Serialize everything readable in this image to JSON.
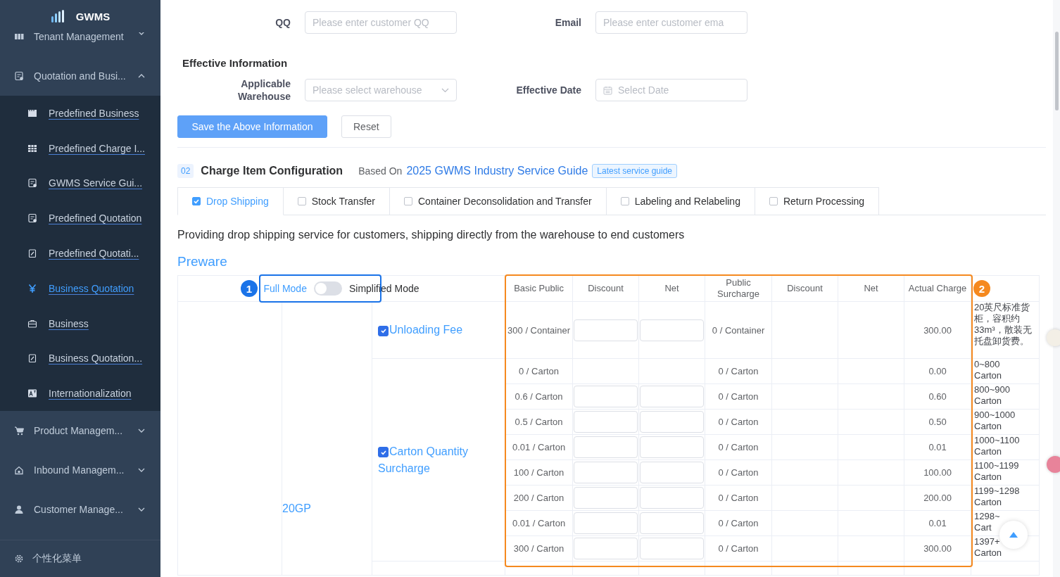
{
  "sidebar": {
    "logo": "GWMS",
    "items": [
      {
        "label": "Tenant Management",
        "expanded": false
      },
      {
        "label": "Quotation and Busi...",
        "expanded": true,
        "children": [
          {
            "label": "Predefined Business",
            "selected": false
          },
          {
            "label": "Predefined Charge I...",
            "selected": false
          },
          {
            "label": "GWMS Service Gui...",
            "selected": false
          },
          {
            "label": "Predefined Quotation",
            "selected": false
          },
          {
            "label": "Predefined Quotati...",
            "selected": false
          },
          {
            "label": "Business Quotation",
            "selected": true
          },
          {
            "label": "Business",
            "selected": false
          },
          {
            "label": "Business Quotation...",
            "selected": false
          },
          {
            "label": "Internationalization",
            "selected": false
          }
        ]
      },
      {
        "label": "Product Managem...",
        "expanded": false
      },
      {
        "label": "Inbound Managem...",
        "expanded": false
      },
      {
        "label": "Customer Manage...",
        "expanded": false
      }
    ],
    "footer": "个性化菜单"
  },
  "contact_fields": [
    {
      "label": "QQ",
      "placeholder": "Please enter customer QQ"
    },
    {
      "label": "Email",
      "placeholder": "Please enter customer ema"
    }
  ],
  "effective": {
    "title": "Effective Information",
    "fields": [
      {
        "label": "Applicable Warehouse",
        "placeholder": "Please select warehouse",
        "kind": "select"
      },
      {
        "label": "Effective Date",
        "placeholder": "Select Date",
        "kind": "date"
      }
    ]
  },
  "buttons": [
    {
      "label": "Save the Above Information",
      "kind": "primary"
    },
    {
      "label": "Reset",
      "kind": "default"
    }
  ],
  "charge_config": {
    "number": "02",
    "title": "Charge Item Configuration",
    "based_on": "Based On",
    "guide_link": "2025 GWMS Industry Service Guide",
    "tag": "Latest service guide",
    "tabs": [
      {
        "label": "Drop Shipping",
        "checked": true,
        "selected": true
      },
      {
        "label": "Stock Transfer",
        "checked": false,
        "selected": false
      },
      {
        "label": "Container Deconsolidation and Transfer",
        "checked": false,
        "selected": false
      },
      {
        "label": "Labeling and Relabeling",
        "checked": false,
        "selected": false
      },
      {
        "label": "Return Processing",
        "checked": false,
        "selected": false
      }
    ],
    "description": "Providing drop shipping service for customers, shipping directly from the warehouse to end customers",
    "section": "Preware",
    "mode_toggle": {
      "left": "Full Mode",
      "right": "Simplified Mode",
      "on": false
    },
    "columns": [
      "Basic Public",
      "Discount",
      "Net",
      "Public Surcharge",
      "Discount",
      "Net",
      "Actual Charge"
    ],
    "container": "20GP",
    "groups": [
      {
        "name": "Unloading Fee",
        "checked": true,
        "rows": [
          {
            "basic": "300 / Container",
            "editable": true,
            "surcharge": "0 / Container",
            "actual": "300.00",
            "note": "20英尺标准货柜，容积约33m³，散装无托盘卸货费。"
          }
        ]
      },
      {
        "name": "Carton Quantity Surcharge",
        "checked": true,
        "rows": [
          {
            "basic": "0 / Carton",
            "editable": false,
            "surcharge": "0 / Carton",
            "actual": "0.00",
            "note": "0~800\nCarton"
          },
          {
            "basic": "0.6 / Carton",
            "editable": true,
            "surcharge": "0 / Carton",
            "actual": "0.60",
            "note": "800~900\nCarton"
          },
          {
            "basic": "0.5 / Carton",
            "editable": true,
            "surcharge": "0 / Carton",
            "actual": "0.50",
            "note": "900~1000\nCarton"
          },
          {
            "basic": "0.01 / Carton",
            "editable": true,
            "surcharge": "0 / Carton",
            "actual": "0.01",
            "note": "1000~1100\nCarton"
          },
          {
            "basic": "100 / Carton",
            "editable": true,
            "surcharge": "0 / Carton",
            "actual": "100.00",
            "note": "1100~1199\nCarton"
          },
          {
            "basic": "200 / Carton",
            "editable": true,
            "surcharge": "0 / Carton",
            "actual": "200.00",
            "note": "1199~1298\nCarton"
          },
          {
            "basic": "0.01 / Carton",
            "editable": true,
            "surcharge": "0 / Carton",
            "actual": "0.01",
            "note": "1298~\nCart"
          },
          {
            "basic": "300 / Carton",
            "editable": true,
            "surcharge": "0 / Carton",
            "actual": "300.00",
            "note": "1397+\nCarton"
          }
        ]
      }
    ]
  },
  "annotations": [
    {
      "label": "1",
      "color": "#1a73e8"
    },
    {
      "label": "2",
      "color": "#f5891f"
    }
  ]
}
